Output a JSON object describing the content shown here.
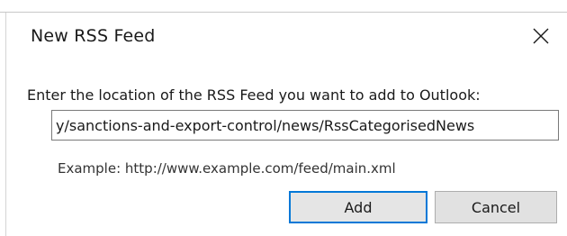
{
  "window": {
    "title": "New RSS Feed",
    "close_icon": "close-icon"
  },
  "form": {
    "prompt": "Enter the location of the RSS Feed you want to add to Outlook:",
    "url_value": "y/sanctions-and-export-control/news/RssCategorisedNews",
    "example": "Example: http://www.example.com/feed/main.xml"
  },
  "buttons": {
    "add_label": "Add",
    "cancel_label": "Cancel"
  },
  "colors": {
    "default_button_border": "#0078d7",
    "button_face": "#e1e1e1"
  }
}
